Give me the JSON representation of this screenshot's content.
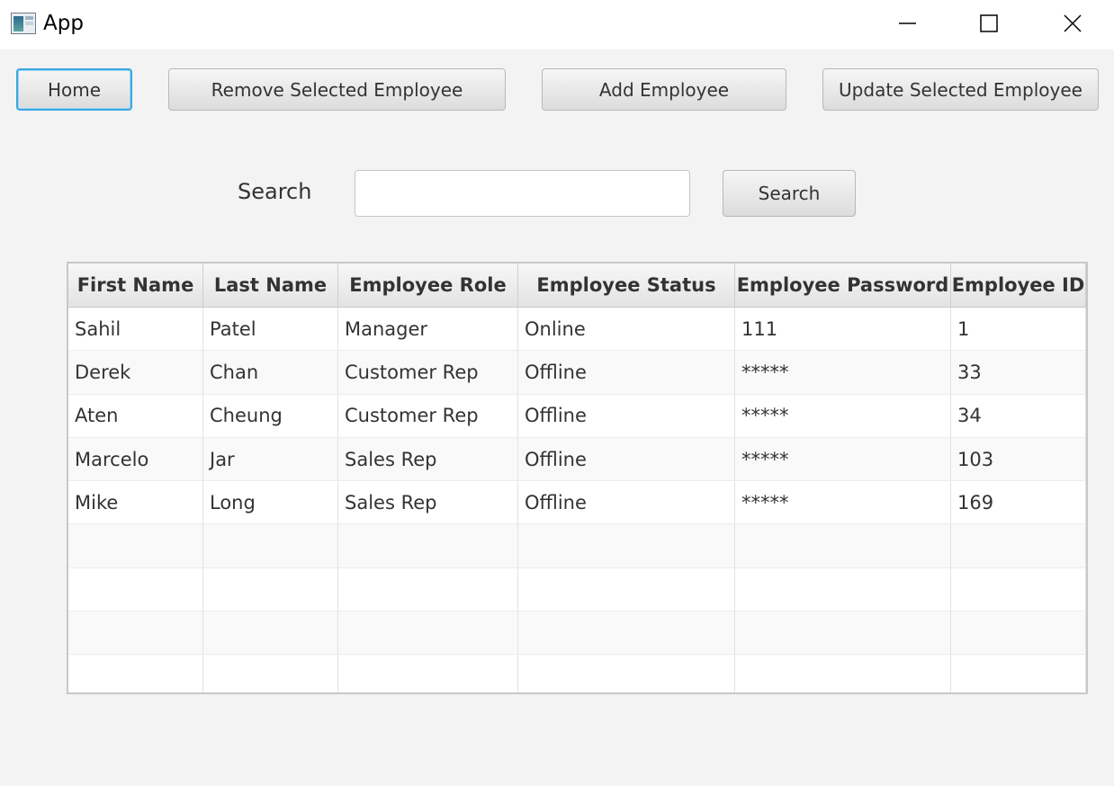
{
  "window": {
    "title": "App",
    "icon": "app-window-icon",
    "controls": [
      "minimize-icon",
      "maximize-icon",
      "close-icon"
    ]
  },
  "toolbar": {
    "home_label": "Home",
    "remove_label": "Remove Selected Employee",
    "add_label": "Add Employee",
    "update_label": "Update Selected Employee"
  },
  "search": {
    "label": "Search",
    "value": "",
    "button_label": "Search"
  },
  "table": {
    "columns": [
      "First Name",
      "Last Name",
      "Employee Role",
      "Employee Status",
      "Employee Password",
      "Employee ID"
    ],
    "rows": [
      [
        "Sahil",
        "Patel",
        "Manager",
        "Online",
        "111",
        "1"
      ],
      [
        "Derek",
        "Chan",
        "Customer Rep",
        "Offline",
        "*****",
        "33"
      ],
      [
        "Aten",
        "Cheung",
        "Customer Rep",
        "Offline",
        "*****",
        "34"
      ],
      [
        "Marcelo",
        "Jar",
        "Sales Rep",
        "Offline",
        "*****",
        "103"
      ],
      [
        "Mike",
        "Long",
        "Sales Rep",
        "Offline",
        "*****",
        "169"
      ],
      [
        "",
        "",
        "",
        "",
        "",
        ""
      ],
      [
        "",
        "",
        "",
        "",
        "",
        ""
      ],
      [
        "",
        "",
        "",
        "",
        "",
        ""
      ],
      [
        "",
        "",
        "",
        "",
        "",
        ""
      ]
    ]
  },
  "colors": {
    "focus_ring": "#3aa8e0",
    "background": "#f3f3f3"
  }
}
